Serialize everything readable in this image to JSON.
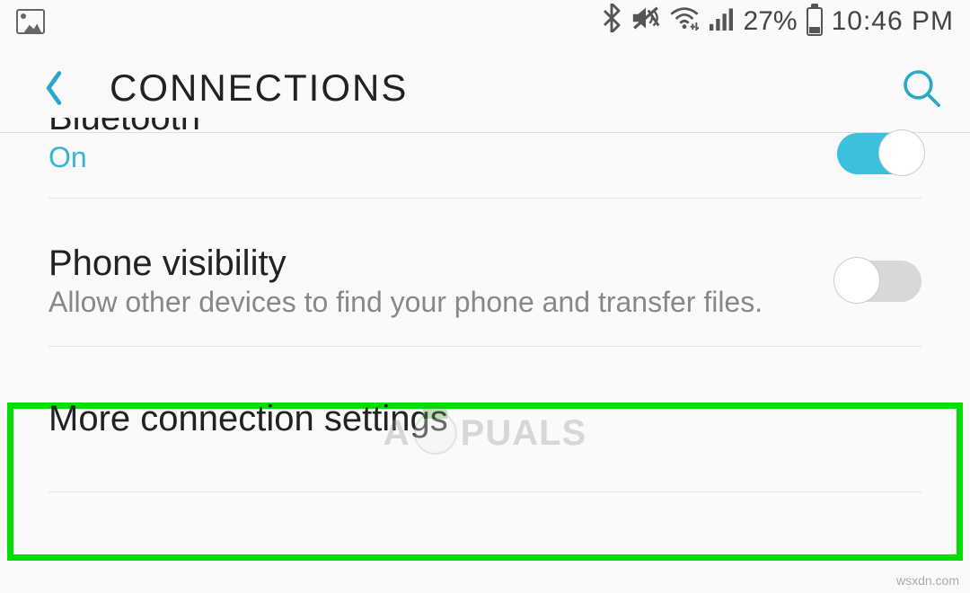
{
  "status_bar": {
    "battery_pct": "27%",
    "time": "10:46 PM"
  },
  "app_bar": {
    "title": "CONNECTIONS"
  },
  "settings": {
    "bluetooth": {
      "title": "Bluetooth",
      "state": "On"
    },
    "phone_visibility": {
      "title": "Phone visibility",
      "subtitle": "Allow other devices to find your phone and transfer files."
    },
    "more_connection": {
      "title": "More connection settings"
    }
  },
  "watermark": {
    "text_left": "A",
    "text_right": "PUALS"
  },
  "source": "wsxdn.com"
}
